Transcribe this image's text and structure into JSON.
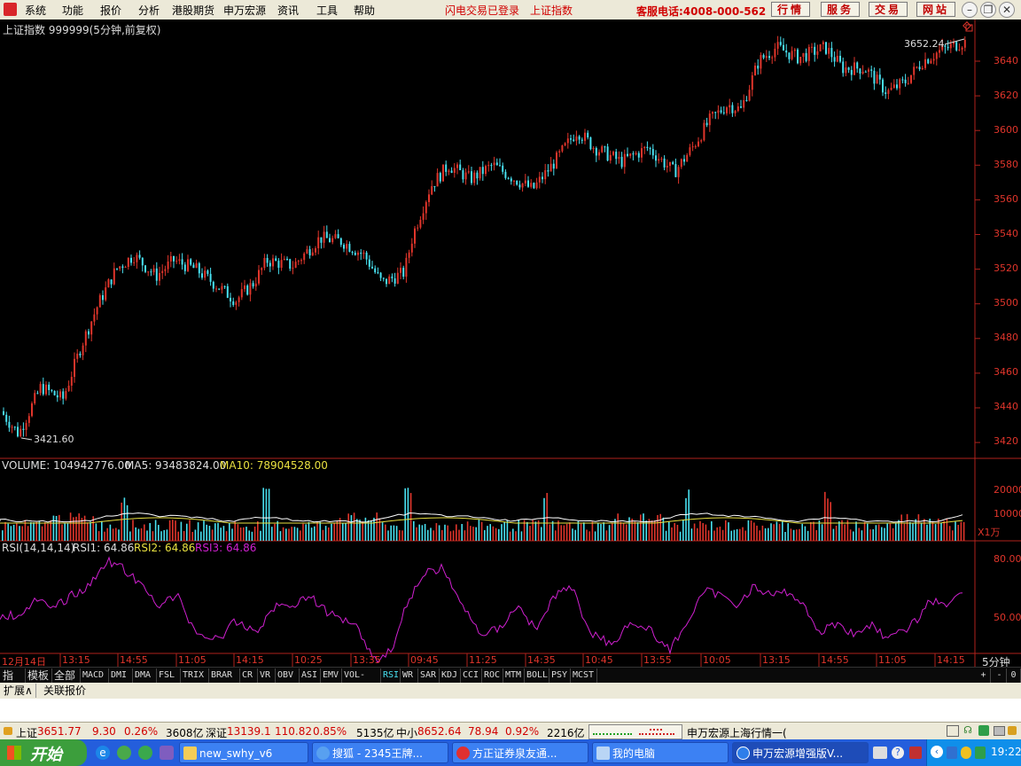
{
  "menu": {
    "items": [
      "系统",
      "功能",
      "报价",
      "分析",
      "港股期货",
      "申万宏源",
      "资讯",
      "工具",
      "帮助"
    ],
    "status_flash": "闪电交易已登录",
    "status_index": "上证指数",
    "hotline": "客服电话:4008-000-562",
    "buttons": [
      "行情",
      "服务",
      "交易",
      "网站"
    ]
  },
  "chart": {
    "title": "上证指数 999999(5分钟,前复权)",
    "high_label": "3652.24",
    "low_label": "3421.60",
    "price_axis": [
      "3640",
      "3620",
      "3600",
      "3580",
      "3560",
      "3540",
      "3520",
      "3500",
      "3480",
      "3460",
      "3440",
      "3420"
    ],
    "volume_header": {
      "label": "VOLUME: 104942776.00",
      "ma5": "MA5: 93483824.00",
      "ma10": "MA10: 78904528.00"
    },
    "volume_axis": [
      "20000",
      "10000"
    ],
    "volume_unit": "X1万",
    "rsi_header": {
      "label": "RSI(14,14,14)",
      "rsi1": "RSI1: 64.86",
      "rsi2": "RSI2: 64.86",
      "rsi3": "RSI3: 64.86"
    },
    "rsi_axis": [
      "80.00",
      "50.00"
    ],
    "time_axis": [
      "12月14日",
      "13:15",
      "14:55",
      "11:05",
      "14:15",
      "10:25",
      "13:35",
      "09:45",
      "11:25",
      "14:35",
      "10:45",
      "13:55",
      "10:05",
      "13:15",
      "14:55",
      "11:05",
      "14:15"
    ],
    "period": "5分钟"
  },
  "colors": {
    "up": "#E0352B",
    "down": "#48E0F0",
    "ma5": "#FFFFFF",
    "ma10": "#E8E040",
    "rsi": "#D020D0",
    "axis": "#B0221C"
  },
  "tabs": [
    "指标",
    "模板",
    "全部",
    "MACD",
    "DMI",
    "DMA",
    "FSL",
    "TRIX",
    "BRAR",
    "CR",
    "VR",
    "OBV",
    "ASI",
    "EMV",
    "VOL-TDX",
    "RSI",
    "WR",
    "SAR",
    "KDJ",
    "CCI",
    "ROC",
    "MTM",
    "BOLL",
    "PSY",
    "MCST"
  ],
  "tab_controls": [
    "+",
    "-",
    "0"
  ],
  "extbar": [
    "扩展∧",
    "关联报价"
  ],
  "status": {
    "sh_name": "上证",
    "sh_value": "3651.77",
    "sh_change": "9.30",
    "sh_pct": "0.26%",
    "sh_amount": "3608亿",
    "sz_name": "深证",
    "sz_value": "13139.1",
    "sz_change": "110.82",
    "sz_pct": "0.85%",
    "sz_amount": "5135亿",
    "zx_name": "中小",
    "zx_value": "8652.64",
    "zx_change": "78.94",
    "zx_pct": "0.92%",
    "zx_amount": "2216亿",
    "broker": "申万宏源上海行情一("
  },
  "taskbar": {
    "start": "开始",
    "tasks": [
      "new_swhy_v6",
      "搜狐 - 2345王牌...",
      "方正证券泉友通...",
      "我的电脑",
      "申万宏源增强版V..."
    ],
    "clock": "19:22"
  }
}
